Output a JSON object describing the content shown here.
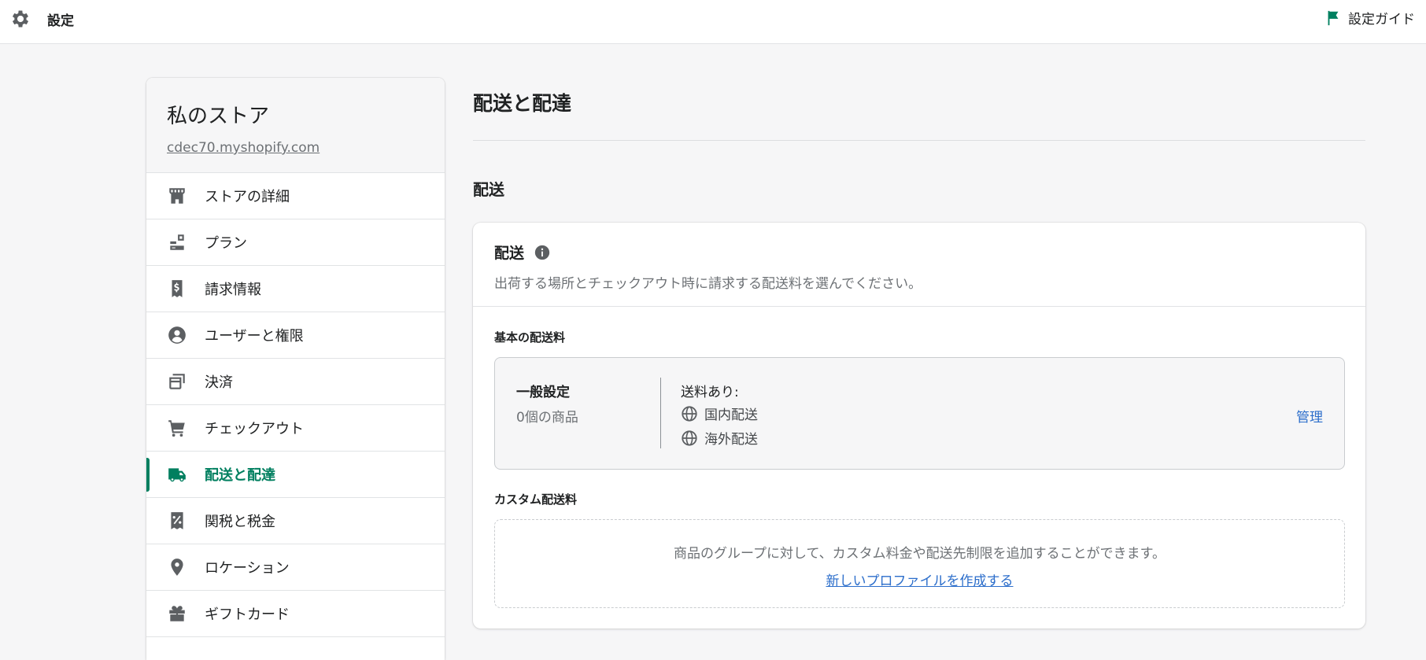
{
  "topbar": {
    "title": "設定",
    "guide_label": "設定ガイド",
    "gear_icon": "gear-icon",
    "flag_icon": "flag-icon",
    "flag_color": "#008060"
  },
  "sidebar": {
    "store_name": "私のストア",
    "store_url": "cdec70.myshopify.com",
    "items": [
      {
        "label": "ストアの詳細",
        "icon": "store-icon"
      },
      {
        "label": "プラン",
        "icon": "plan-icon"
      },
      {
        "label": "請求情報",
        "icon": "billing-icon"
      },
      {
        "label": "ユーザーと権限",
        "icon": "user-icon"
      },
      {
        "label": "決済",
        "icon": "payment-icon"
      },
      {
        "label": "チェックアウト",
        "icon": "cart-icon"
      },
      {
        "label": "配送と配達",
        "icon": "truck-icon",
        "active": true
      },
      {
        "label": "関税と税金",
        "icon": "tax-icon"
      },
      {
        "label": "ロケーション",
        "icon": "location-icon"
      },
      {
        "label": "ギフトカード",
        "icon": "gift-icon"
      }
    ],
    "active_color": "#007f5f"
  },
  "main": {
    "page_title": "配送と配達",
    "section_title": "配送",
    "card": {
      "title": "配送",
      "info_icon": "info-icon",
      "description": "出荷する場所とチェックアウト時に請求する配送料を選んでください。",
      "basic_label": "基本の配送料",
      "general": {
        "name": "一般設定",
        "count": "0個の商品",
        "fee_label": "送料あり:",
        "zones": [
          "国内配送",
          "海外配送"
        ],
        "manage_label": "管理"
      },
      "custom_label": "カスタム配送料",
      "custom_description": "商品のグループに対して、カスタム料金や配送先制限を追加することができます。",
      "custom_link": "新しいプロファイルを作成する"
    },
    "link_color": "#2c6ecb"
  }
}
